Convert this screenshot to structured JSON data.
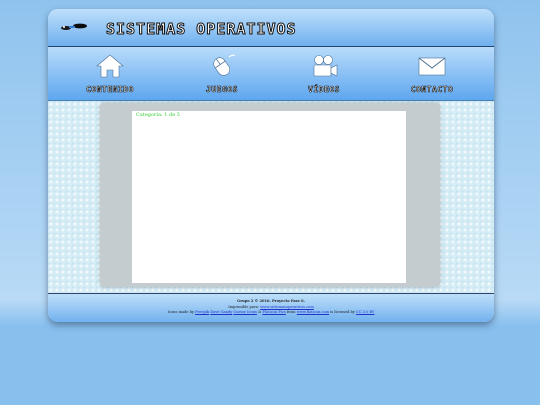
{
  "site": {
    "title": "Sistemas Operativos"
  },
  "nav": {
    "items": [
      {
        "label": "Contenido",
        "icon": "home-icon"
      },
      {
        "label": "Juegos",
        "icon": "mouse-icon"
      },
      {
        "label": "Vídeos",
        "icon": "video-camera-icon"
      },
      {
        "label": "Contacto",
        "icon": "mail-icon"
      }
    ]
  },
  "content": {
    "text": "Categoría: 1 de 5"
  },
  "footer": {
    "line1": "Grupo 2 © 2016. Proyecto Fase 6.",
    "line2_prefix": "Imprimible para:",
    "line2_link": "www.sistemasoperativos.com",
    "line3": {
      "prefix": "Icons made by",
      "link1": "Freepik",
      "link2": "Dave Gandy",
      "link3": "Cursor Icons",
      "amp": "&",
      "link4": "Flaticon Pics",
      "from": "from",
      "link5": "www.flaticon.com",
      "licensed": "is licensed by",
      "link6": "CC 3.0 BY"
    }
  },
  "colors": {
    "header_top": "#bfe0fb",
    "header_bottom": "#6fb0ef",
    "nav_text_stroke": "#111111",
    "content_text": "#33cc33",
    "page_bg": "#88c0ee"
  }
}
